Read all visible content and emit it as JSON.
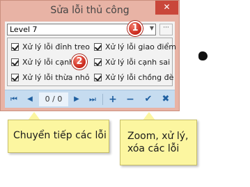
{
  "window": {
    "title": "Sửa lỗi thủ công",
    "close_glyph": "✕"
  },
  "level": {
    "value": "Level 7",
    "arrow": "▼",
    "more_label": "···"
  },
  "checkboxes": [
    {
      "label": "Xử lý lỗi đỉnh treo",
      "checked": true
    },
    {
      "label": "Xử lý lỗi giao điểm",
      "checked": true
    },
    {
      "label": "Xử lý lỗi cạnh",
      "checked": true
    },
    {
      "label": "Xử lý lỗi cạnh sai",
      "checked": true
    },
    {
      "label": "Xử lý lỗi thừa nhỏ",
      "checked": true
    },
    {
      "label": "Xử lý lỗi chồng đè",
      "checked": true
    }
  ],
  "navigation": {
    "first": "⏮",
    "prev": "◀",
    "page": "0 / 0",
    "next": "▶",
    "last": "⏭"
  },
  "tools": {
    "zoom_in": "+",
    "zoom_out": "−",
    "apply": "✔",
    "delete": "✖"
  },
  "badges": [
    "1",
    "2"
  ],
  "callouts": {
    "left": "Chuyển tiếp các lỗi",
    "right": "Zoom, xử lý, xóa các lỗi"
  },
  "colors": {
    "window_frame": "#e8b3a5",
    "close_button": "#c9473a",
    "toolbar": "#c6dcf0",
    "toolbar_icons": "#1f5fa0",
    "badge": "#c8261a",
    "callout": "#fcf6a0"
  }
}
